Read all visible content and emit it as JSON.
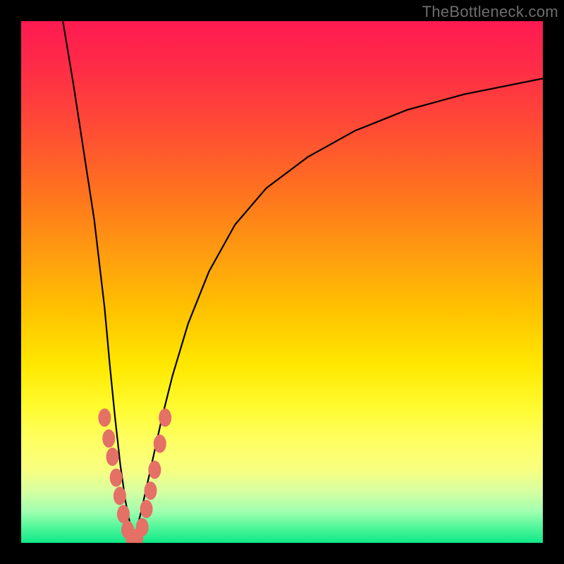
{
  "watermark": "TheBottleneck.com",
  "colors": {
    "frame": "#000000",
    "curve": "#000000",
    "marker": "#e47066",
    "gradient_top": "#ff1a52",
    "gradient_bottom": "#10e888"
  },
  "chart_data": {
    "type": "line",
    "title": "",
    "xlabel": "",
    "ylabel": "",
    "xlim": [
      0,
      100
    ],
    "ylim": [
      0,
      100
    ],
    "grid": false,
    "legend": false,
    "note": "Axes have no visible tick labels; values are read as percent of plot width/height. y=0 at bottom (green).",
    "series": [
      {
        "name": "left-branch",
        "x": [
          8,
          10,
          12,
          14,
          16,
          17,
          18,
          19,
          20,
          21,
          21.5
        ],
        "y": [
          100,
          88,
          75,
          62,
          45,
          34,
          24,
          15,
          8,
          3,
          0
        ]
      },
      {
        "name": "right-branch",
        "x": [
          21.5,
          23,
          25,
          27,
          29,
          32,
          36,
          41,
          47,
          55,
          64,
          74,
          85,
          100
        ],
        "y": [
          0,
          6,
          15,
          24,
          32,
          42,
          52,
          61,
          68,
          74,
          79,
          83,
          86,
          89
        ]
      }
    ],
    "markers": [
      {
        "x": 16.0,
        "y": 24.0
      },
      {
        "x": 16.8,
        "y": 20.0
      },
      {
        "x": 17.5,
        "y": 16.5
      },
      {
        "x": 18.2,
        "y": 12.5
      },
      {
        "x": 18.9,
        "y": 9.0
      },
      {
        "x": 19.6,
        "y": 5.5
      },
      {
        "x": 20.4,
        "y": 2.5
      },
      {
        "x": 21.2,
        "y": 1.0
      },
      {
        "x": 22.2,
        "y": 1.0
      },
      {
        "x": 23.2,
        "y": 3.0
      },
      {
        "x": 24.0,
        "y": 6.5
      },
      {
        "x": 24.8,
        "y": 10.0
      },
      {
        "x": 25.6,
        "y": 14.0
      },
      {
        "x": 26.6,
        "y": 19.0
      },
      {
        "x": 27.6,
        "y": 24.0
      }
    ]
  }
}
